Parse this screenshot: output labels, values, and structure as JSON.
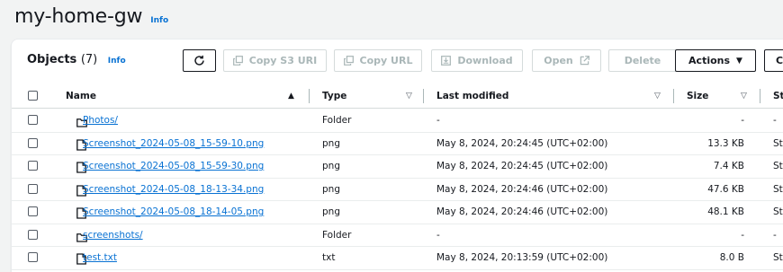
{
  "bucket": {
    "title": "my-home-gw",
    "info": "Info"
  },
  "objects": {
    "heading": "Objects",
    "count": "(7)",
    "info": "Info"
  },
  "toolbar": {
    "refresh_icon": "refresh-icon",
    "copy_s3_uri": "Copy S3 URI",
    "copy_url": "Copy URL",
    "download": "Download",
    "open": "Open",
    "delete": "Delete",
    "actions": "Actions",
    "create_folder_partial": "C"
  },
  "columns": {
    "name": "Name",
    "type": "Type",
    "last_modified": "Last modified",
    "size": "Size",
    "storage_class_partial": "St"
  },
  "rows": [
    {
      "kind": "folder",
      "name": "Photos/",
      "type": "Folder",
      "last_modified": "-",
      "size": "-",
      "storage": "-"
    },
    {
      "kind": "file",
      "name": "Screenshot_2024-05-08_15-59-10.png",
      "type": "png",
      "last_modified": "May 8, 2024, 20:24:45 (UTC+02:00)",
      "size": "13.3 KB",
      "storage": "St"
    },
    {
      "kind": "file",
      "name": "Screenshot_2024-05-08_15-59-30.png",
      "type": "png",
      "last_modified": "May 8, 2024, 20:24:45 (UTC+02:00)",
      "size": "7.4 KB",
      "storage": "St"
    },
    {
      "kind": "file",
      "name": "Screenshot_2024-05-08_18-13-34.png",
      "type": "png",
      "last_modified": "May 8, 2024, 20:24:46 (UTC+02:00)",
      "size": "47.6 KB",
      "storage": "St"
    },
    {
      "kind": "file",
      "name": "Screenshot_2024-05-08_18-14-05.png",
      "type": "png",
      "last_modified": "May 8, 2024, 20:24:46 (UTC+02:00)",
      "size": "48.1 KB",
      "storage": "St"
    },
    {
      "kind": "folder",
      "name": "screenshots/",
      "type": "Folder",
      "last_modified": "-",
      "size": "-",
      "storage": "-"
    },
    {
      "kind": "file",
      "name": "test.txt",
      "type": "txt",
      "last_modified": "May 8, 2024, 20:13:59 (UTC+02:00)",
      "size": "8.0 B",
      "storage": "St"
    }
  ],
  "colors": {
    "link": "#0972d3",
    "text": "#16191f",
    "disabled": "#aab7b8",
    "border": "#d5dbdb"
  }
}
